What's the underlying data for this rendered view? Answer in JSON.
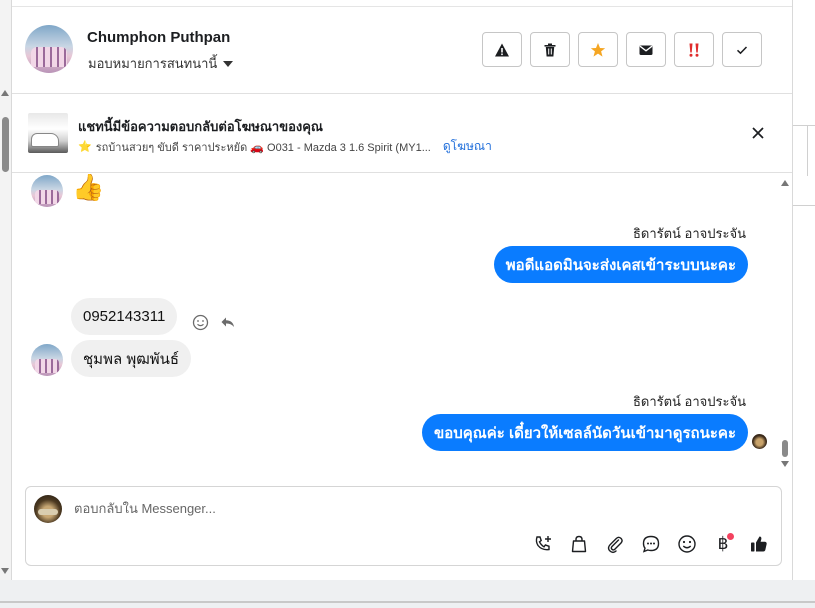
{
  "header": {
    "contact_name": "Chumphon Puthpan",
    "assign_label": "มอบหมายการสนทนานี้",
    "actions": [
      {
        "name": "report-button",
        "icon": "warning-icon"
      },
      {
        "name": "delete-button",
        "icon": "trash-icon"
      },
      {
        "name": "star-button",
        "icon": "star-icon",
        "color": "#f5a623"
      },
      {
        "name": "mark-unread-button",
        "icon": "envelope-icon"
      },
      {
        "name": "spam-button",
        "icon": "double-exclamation-icon",
        "color": "#e02c2c"
      },
      {
        "name": "done-button",
        "icon": "check-icon"
      }
    ]
  },
  "ad": {
    "title": "แชทนี้มีข้อความตอบกลับต่อโฆษณาของคุณ",
    "subtitle": "รถบ้านสวยๆ ขับดี ราคาประหยัด 🚗 O031 - Mazda 3 1.6 Spirit (MY1...",
    "link_label": "ดูโฆษณา"
  },
  "messages": {
    "first_emoji": "👍",
    "out1_sender": "ธิดารัตน์ อาจประจัน",
    "out1_text": "พอดีแอดมินจะส่งเคสเข้าระบบนะคะ",
    "in_phone": "0952143311",
    "in_name": "ชุมพล พุฒพันธ์",
    "out2_sender": "ธิดารัตน์ อาจประจัน",
    "out2_text": "ขอบคุณค่ะ เดี๋ยวให้เซลล์นัดวันเข้ามาดูรถนะคะ"
  },
  "composer": {
    "placeholder": "ตอบกลับใน Messenger...",
    "baht_symbol": "฿"
  },
  "colors": {
    "outgoing_bubble": "#0a7cff",
    "incoming_bubble": "#f0f0f0",
    "link": "#216fdb"
  }
}
